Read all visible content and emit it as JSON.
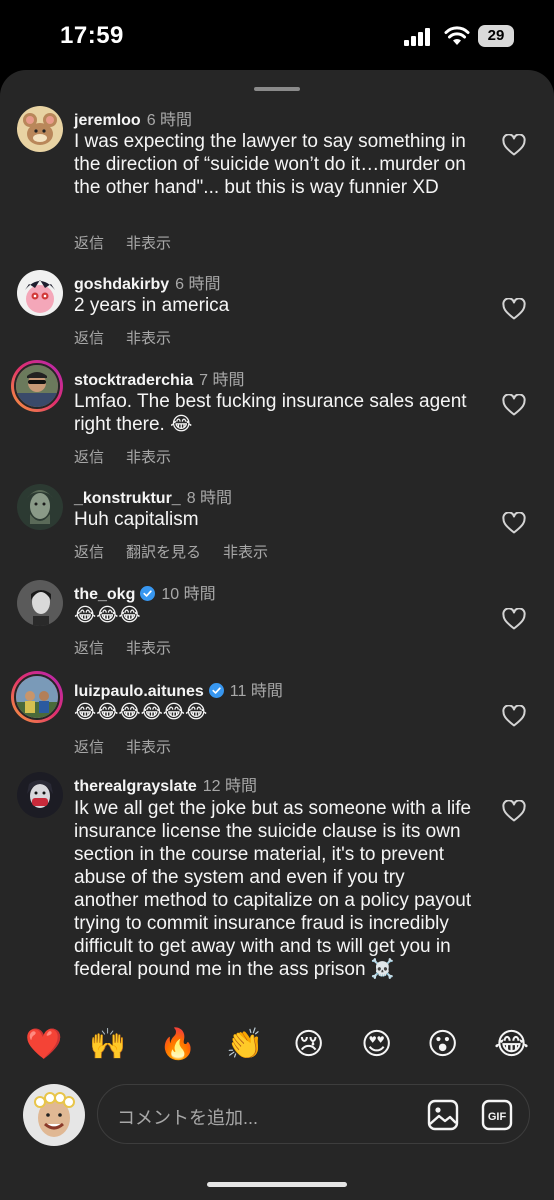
{
  "status": {
    "time": "17:59",
    "battery": "29"
  },
  "comments": [
    {
      "username": "jeremloo",
      "time": "6 時間",
      "text": "I was expecting the lawyer to say something in the direction of “suicide won’t do it…murder on the other hand\"... but this is way funnier XD",
      "reply": "返信",
      "hide": "非表示"
    },
    {
      "username": "goshdakirby",
      "time": "6 時間",
      "text": "2 years in america",
      "reply": "返信",
      "hide": "非表示"
    },
    {
      "username": "stocktraderchia",
      "time": "7 時間",
      "text": "Lmfao. The best fucking insurance sales agent right there. 😂",
      "reply": "返信",
      "hide": "非表示"
    },
    {
      "username": "_konstruktur_",
      "time": "8 時間",
      "text": "Huh capitalism",
      "reply": "返信",
      "translate": "翻訳を見る",
      "hide": "非表示"
    },
    {
      "username": "the_okg",
      "time": "10 時間",
      "text": "😂😂😂",
      "reply": "返信",
      "hide": "非表示"
    },
    {
      "username": "luizpaulo.aitunes",
      "time": "11 時間",
      "text": "😂😂😂😂😂😂",
      "reply": "返信",
      "hide": "非表示"
    },
    {
      "username": "therealgrayslate",
      "time": "12 時間",
      "text": "Ik we all get the joke but as someone with a life insurance license the suicide clause is its own section in the course material, it's to prevent abuse of the system and even if you try another method to capitalize on a policy payout trying to commit insurance fraud is incredibly difficult to get away with and ts will get you in federal pound me in the ass prison ☠️"
    }
  ],
  "reactions": [
    "❤️",
    "🙌",
    "🔥",
    "👏",
    "😢",
    "😍",
    "😮",
    "😂"
  ],
  "composer": {
    "placeholder": "コメントを追加..."
  },
  "colors": {
    "background": "#262626",
    "text": "#f5f5f5",
    "secondary": "#a8a8a8",
    "verified": "#3897f0"
  }
}
